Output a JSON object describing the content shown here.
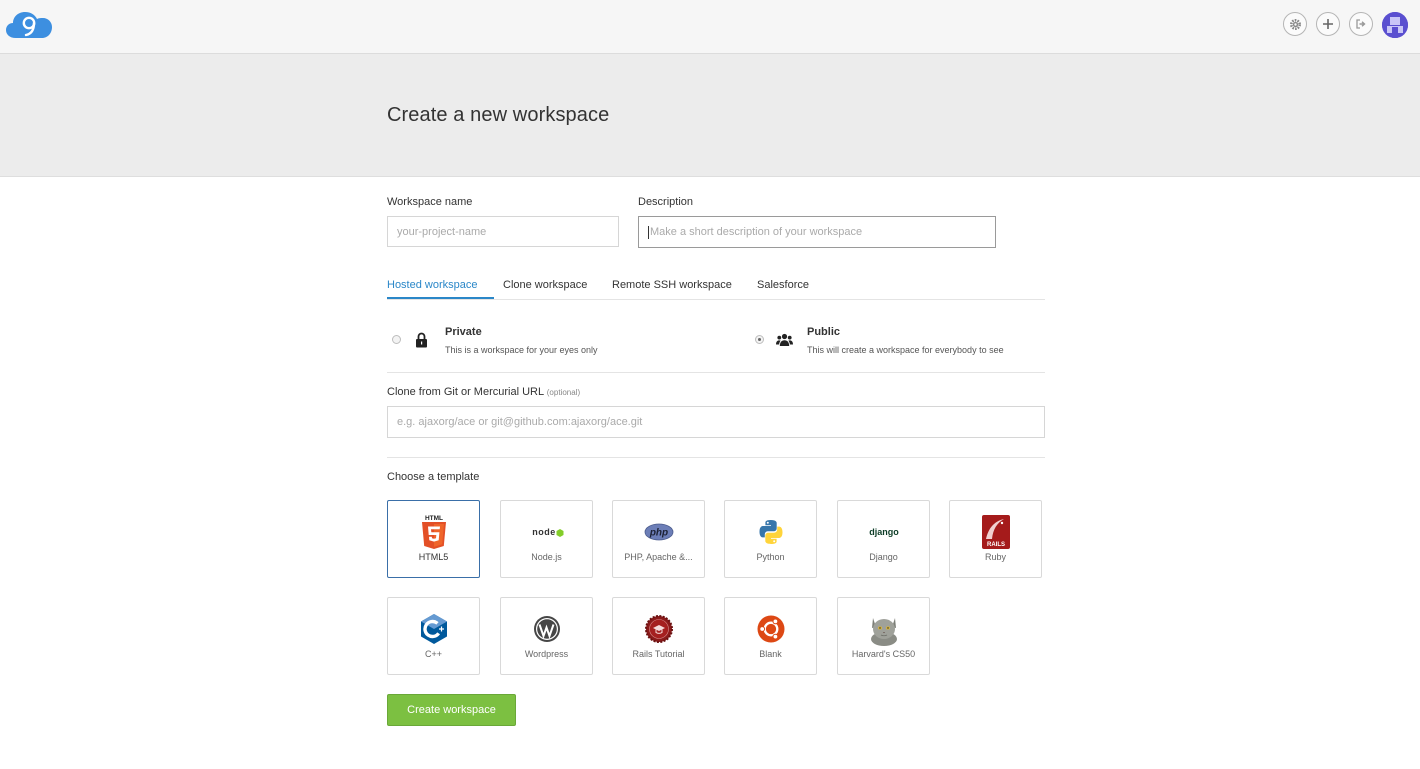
{
  "header": {
    "logo_icon": "cloud9-logo-icon",
    "actions": [
      {
        "name": "settings",
        "icon": "gear-icon"
      },
      {
        "name": "new",
        "icon": "plus-icon"
      },
      {
        "name": "logout",
        "icon": "sign-out-icon"
      }
    ],
    "avatar_icon": "user-avatar-icon"
  },
  "page": {
    "title": "Create a new workspace"
  },
  "form": {
    "workspace_name": {
      "label": "Workspace name",
      "placeholder": "your-project-name",
      "value": ""
    },
    "description": {
      "label": "Description",
      "placeholder": "Make a short description of your workspace",
      "value": ""
    },
    "tabs": [
      {
        "label": "Hosted workspace",
        "active": true
      },
      {
        "label": "Clone workspace",
        "active": false
      },
      {
        "label": "Remote SSH workspace",
        "active": false
      },
      {
        "label": "Salesforce",
        "active": false
      }
    ],
    "visibility": {
      "private": {
        "title": "Private",
        "desc": "This is a workspace for your eyes only",
        "icon": "lock-icon",
        "selected": false
      },
      "public": {
        "title": "Public",
        "desc": "This will create a workspace for everybody to see",
        "icon": "users-icon",
        "selected": true
      }
    },
    "clone": {
      "label": "Clone from Git or Mercurial URL",
      "optional": "(optional)",
      "placeholder": "e.g. ajaxorg/ace or git@github.com:ajaxorg/ace.git"
    },
    "templates_label": "Choose a template",
    "templates": [
      {
        "label": "HTML5",
        "icon": "html5-icon",
        "selected": true
      },
      {
        "label": "Node.js",
        "icon": "nodejs-icon",
        "selected": false
      },
      {
        "label": "PHP, Apache &...",
        "icon": "php-icon",
        "selected": false
      },
      {
        "label": "Python",
        "icon": "python-icon",
        "selected": false
      },
      {
        "label": "Django",
        "icon": "django-icon",
        "selected": false
      },
      {
        "label": "Ruby",
        "icon": "rails-icon",
        "selected": false
      },
      {
        "label": "C++",
        "icon": "cpp-icon",
        "selected": false
      },
      {
        "label": "Wordpress",
        "icon": "wordpress-icon",
        "selected": false
      },
      {
        "label": "Rails Tutorial",
        "icon": "rails-tutorial-icon",
        "selected": false
      },
      {
        "label": "Blank",
        "icon": "ubuntu-icon",
        "selected": false
      },
      {
        "label": "Harvard's CS50",
        "icon": "cs50-cat-icon",
        "selected": false
      }
    ],
    "logo_text": {
      "html5": "HTML",
      "nodejs": "node",
      "php": "php",
      "django": "django",
      "rails": "RAILS"
    },
    "submit_label": "Create workspace"
  },
  "colors": {
    "accent": "#2a87c8",
    "submit": "#7cc041",
    "selected_tile": "#3a6fa8"
  }
}
